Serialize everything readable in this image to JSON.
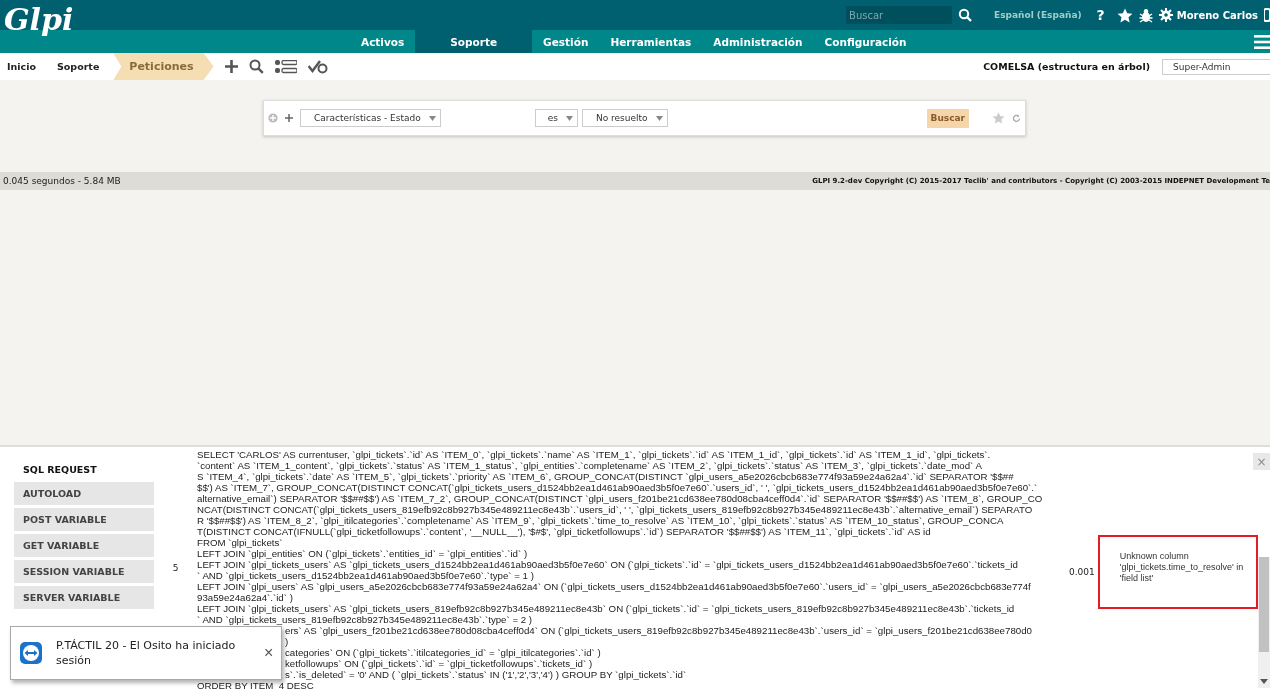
{
  "header": {
    "logo": "Glpi",
    "search": {
      "placeholder": "Buscar"
    },
    "language": "Español (España)",
    "help": "?",
    "user_name": "Moreno Carlos"
  },
  "nav": [
    {
      "label": "Activos",
      "selected": false
    },
    {
      "label": "Soporte",
      "selected": true
    },
    {
      "label": "Gestión",
      "selected": false
    },
    {
      "label": "Herramientas",
      "selected": false
    },
    {
      "label": "Administración",
      "selected": false
    },
    {
      "label": "Configuración",
      "selected": false
    }
  ],
  "breadcrumb": [
    {
      "label": "Inicio",
      "selected": false
    },
    {
      "label": "Soporte",
      "selected": false
    },
    {
      "label": "Peticiones",
      "selected": true
    }
  ],
  "entity": "COMELSA (estructura en árbol)",
  "profile": "Super-Admin",
  "search_panel": {
    "field": "Características - Estado",
    "operator": "es",
    "value": "No resuelto",
    "button": "Buscar"
  },
  "footer": {
    "stats": "0.045 segundos - 5.84 MB",
    "copyright": "GLPI 9.2-dev Copyright (C) 2015-2017 Teclib' and contributors - Copyright (C) 2003-2015 INDEPNET Development Te"
  },
  "debug": {
    "close": "×",
    "tabs": [
      {
        "label": "SQL REQUEST",
        "selected": true
      },
      {
        "label": "AUTOLOAD",
        "selected": false
      },
      {
        "label": "POST VARIABLE",
        "selected": false
      },
      {
        "label": "GET VARIABLE",
        "selected": false
      },
      {
        "label": "SESSION VARIABLE",
        "selected": false
      },
      {
        "label": "SERVER VARIABLE",
        "selected": false
      }
    ],
    "query": {
      "number": "5",
      "time": "0.001",
      "error": "Unknown column 'glpi_tickets.time_to_resolve' in 'field list'",
      "lines": [
        {
          "kind": "full",
          "text": "SELECT 'CARLOS' AS currentuser, `glpi_tickets`.`id` AS `ITEM_0`, `glpi_tickets`.`name` AS `ITEM_1`, `glpi_tickets`.`id` AS `ITEM_1_id`, `glpi_tickets`.`id` AS `ITEM_1_id`, `glpi_tickets`."
        },
        {
          "kind": "full",
          "text": "`content` AS `ITEM_1_content`, `glpi_tickets`.`status` AS `ITEM_1_status`, `glpi_entities`.`completename` AS `ITEM_2`, `glpi_tickets`.`status` AS `ITEM_3`, `glpi_tickets`.`date_mod` A"
        },
        {
          "kind": "full",
          "text": "S `ITEM_4`, `glpi_tickets`.`date` AS `ITEM_5`, `glpi_tickets`.`priority` AS `ITEM_6`, GROUP_CONCAT(DISTINCT `glpi_users_a5e2026cbcb683e774f93a59e24a62a4`.`id` SEPARATOR '$$##"
        },
        {
          "kind": "full",
          "text": "$$') AS `ITEM_7`, GROUP_CONCAT(DISTINCT CONCAT(`glpi_tickets_users_d1524bb2ea1d461ab90aed3b5f0e7e60`.`users_id`, ' ', `glpi_tickets_users_d1524bb2ea1d461ab90aed3b5f0e7e60`.`"
        },
        {
          "kind": "full",
          "text": "alternative_email`) SEPARATOR '$$##$$') AS `ITEM_7_2`, GROUP_CONCAT(DISTINCT `glpi_users_f201be21cd638ee780d08cba4ceff0d4`.`id` SEPARATOR '$$##$$') AS `ITEM_8`, GROUP_CO"
        },
        {
          "kind": "full",
          "text": "NCAT(DISTINCT CONCAT(`glpi_tickets_users_819efb92c8b927b345e489211ec8e43b`.`users_id`, ' ', `glpi_tickets_users_819efb92c8b927b345e489211ec8e43b`.`alternative_email`) SEPARATO"
        },
        {
          "kind": "full",
          "text": "R '$$##$$') AS `ITEM_8_2`, `glpi_itilcategories`.`completename` AS `ITEM_9`, `glpi_tickets`.`time_to_resolve` AS `ITEM_10`, `glpi_tickets`.`status` AS `ITEM_10_status`, GROUP_CONCA"
        },
        {
          "kind": "full",
          "text": "T(DISTINCT CONCAT(IFNULL(`glpi_ticketfollowups`.`content`, '__NULL__'), '$#$', `glpi_ticketfollowups`.`id`) SEPARATOR '$$##$$') AS `ITEM_11`, `glpi_tickets`.`id` AS id"
        },
        {
          "kind": "full",
          "text": "FROM `glpi_tickets`"
        },
        {
          "kind": "full",
          "text": "LEFT JOIN `glpi_entities` ON (`glpi_tickets`.`entities_id` = `glpi_entities`.`id` )"
        },
        {
          "kind": "full",
          "text": "LEFT JOIN `glpi_tickets_users` AS `glpi_tickets_users_d1524bb2ea1d461ab90aed3b5f0e7e60` ON (`glpi_tickets`.`id` = `glpi_tickets_users_d1524bb2ea1d461ab90aed3b5f0e7e60`.`tickets_id"
        },
        {
          "kind": "full",
          "text": "` AND `glpi_tickets_users_d1524bb2ea1d461ab90aed3b5f0e7e60`.`type` = 1 )"
        },
        {
          "kind": "full",
          "text": "LEFT JOIN `glpi_users` AS `glpi_users_a5e2026cbcb683e774f93a59e24a62a4` ON (`glpi_tickets_users_d1524bb2ea1d461ab90aed3b5f0e7e60`.`users_id` = `glpi_users_a5e2026cbcb683e774f"
        },
        {
          "kind": "full",
          "text": "93a59e24a62a4`.`id` )"
        },
        {
          "kind": "full",
          "text": "LEFT JOIN `glpi_tickets_users` AS `glpi_tickets_users_819efb92c8b927b345e489211ec8e43b` ON (`glpi_tickets`.`id` = `glpi_tickets_users_819efb92c8b927b345e489211ec8e43b`.`tickets_id"
        },
        {
          "kind": "full",
          "text": "` AND `glpi_tickets_users_819efb92c8b927b345e489211ec8e43b`.`type` = 2 )"
        },
        {
          "kind": "covered",
          "text": "ers` AS `glpi_users_f201be21cd638ee780d08cba4ceff0d4` ON (`glpi_tickets_users_819efb92c8b927b345e489211ec8e43b`.`users_id` = `glpi_users_f201be21cd638ee780d0"
        },
        {
          "kind": "covered",
          "text": ")"
        },
        {
          "kind": "covered",
          "text": "categories` ON (`glpi_tickets`.`itilcategories_id` = `glpi_itilcategories`.`id` )"
        },
        {
          "kind": "covered",
          "text": "ketfollowups` ON (`glpi_tickets`.`id` = `glpi_ticketfollowups`.`tickets_id` )"
        },
        {
          "kind": "covered",
          "text": "s`.`is_deleted` = '0' AND ( `glpi_tickets`.`status` IN ('1','2','3','4') ) GROUP BY `glpi_tickets`.`id`"
        },
        {
          "kind": "full",
          "text": "ORDER BY ITEM_4 DESC"
        }
      ]
    }
  },
  "notification": {
    "message": "P.TÁCTIL 20 - El Osito ha iniciado sesión",
    "close": "×"
  }
}
